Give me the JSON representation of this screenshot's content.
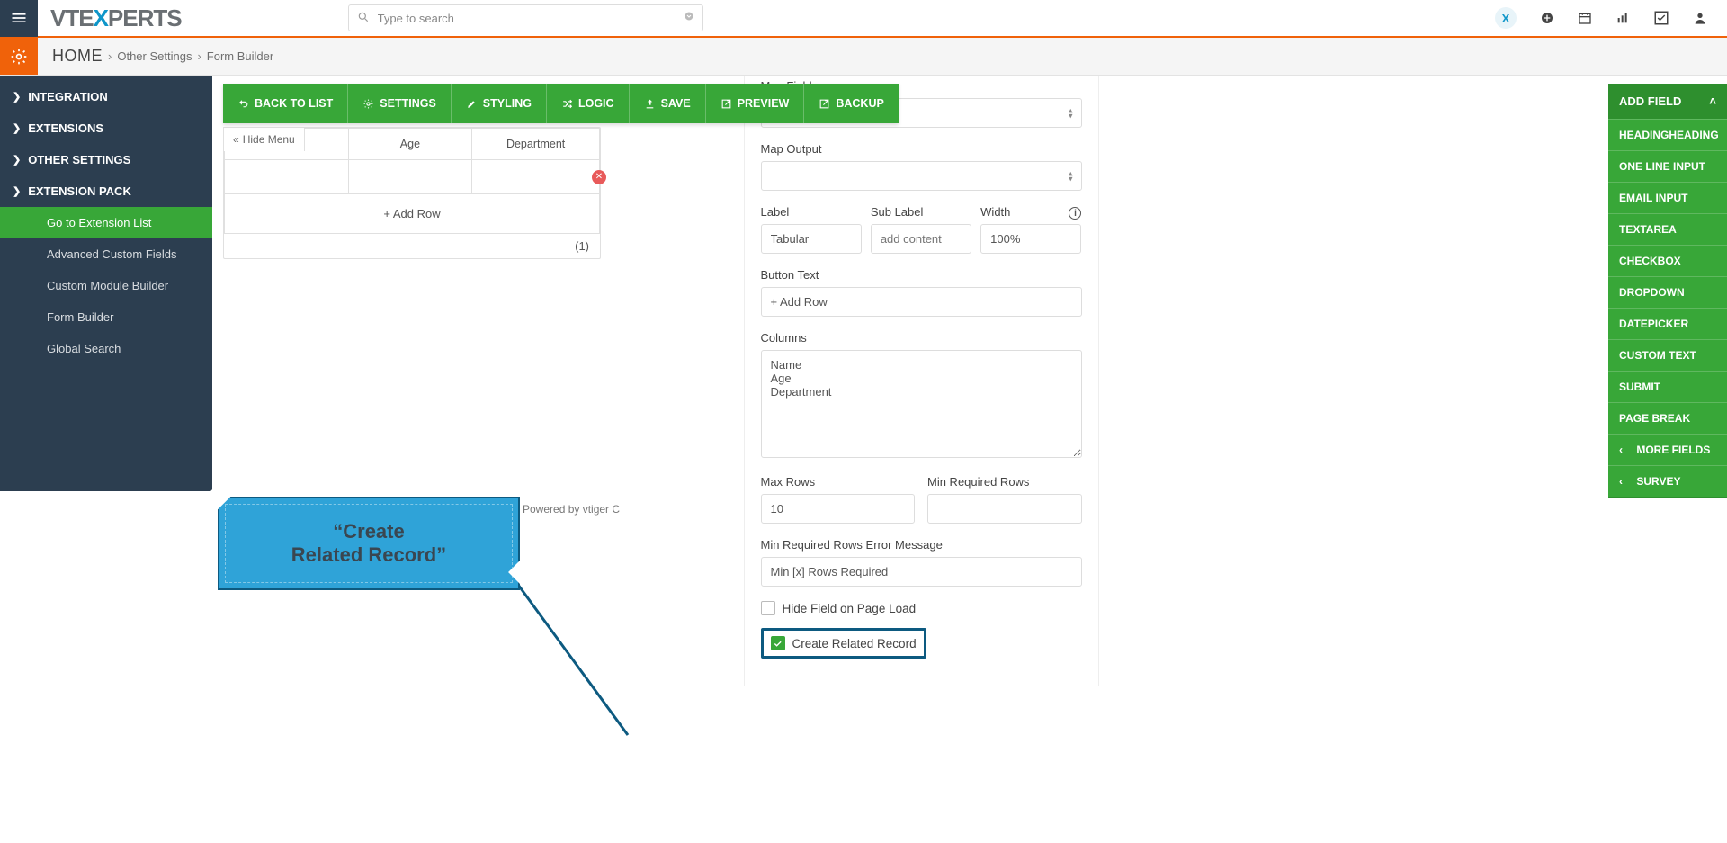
{
  "search": {
    "placeholder": "Type to search"
  },
  "breadcrumb": {
    "home": "HOME",
    "mid": "Other Settings",
    "last": "Form Builder"
  },
  "nav": {
    "integration": "INTEGRATION",
    "extensions": "EXTENSIONS",
    "other_settings": "OTHER SETTINGS",
    "extension_pack": "EXTENSION PACK",
    "sub": {
      "go_ext_list": "Go to Extension List",
      "adv_custom_fields": "Advanced Custom Fields",
      "custom_module_builder": "Custom Module Builder",
      "form_builder": "Form Builder",
      "global_search": "Global Search"
    }
  },
  "toolbar": {
    "back": "BACK TO LIST",
    "settings": "SETTINGS",
    "styling": "STYLING",
    "logic": "LOGIC",
    "save": "SAVE",
    "preview": "PREVIEW",
    "backup": "BACKUP"
  },
  "preview": {
    "hide_menu": "Hide Menu",
    "col_age": "Age",
    "col_dept": "Department",
    "add_row": "+ Add Row",
    "count": "(1)"
  },
  "callout": {
    "line1": "“Create",
    "line2": "Related Record”"
  },
  "poweredby": "Powered by vtiger C",
  "props": {
    "map_field_label": "Map Field",
    "map_output_label": "Map Output",
    "label_label": "Label",
    "sublabel_label": "Sub Label",
    "width_label": "Width",
    "label_value": "Tabular",
    "sublabel_placeholder": "add content",
    "width_value": "100%",
    "button_text_label": "Button Text",
    "button_text_value": "+ Add Row",
    "columns_label": "Columns",
    "columns_value": "Name\nAge\nDepartment",
    "max_rows_label": "Max Rows",
    "max_rows_value": "10",
    "min_rows_label": "Min Required Rows",
    "min_rows_err_label": "Min Required Rows Error Message",
    "min_rows_err_value": "Min [x] Rows Required",
    "hide_field_label": "Hide Field on Page Load",
    "create_related_label": "Create Related Record"
  },
  "rightpanel": {
    "header": "ADD FIELD",
    "items": {
      "heading": "HEADINGHEADING",
      "oneline": "ONE LINE INPUT",
      "email": "EMAIL INPUT",
      "textarea": "TEXTAREA",
      "checkbox": "CHECKBOX",
      "dropdown": "DROPDOWN",
      "datepicker": "DATEPICKER",
      "customtext": "CUSTOM TEXT",
      "submit": "SUBMIT",
      "pagebreak": "PAGE BREAK",
      "morefields": "MORE FIELDS",
      "survey": "SURVEY"
    }
  }
}
